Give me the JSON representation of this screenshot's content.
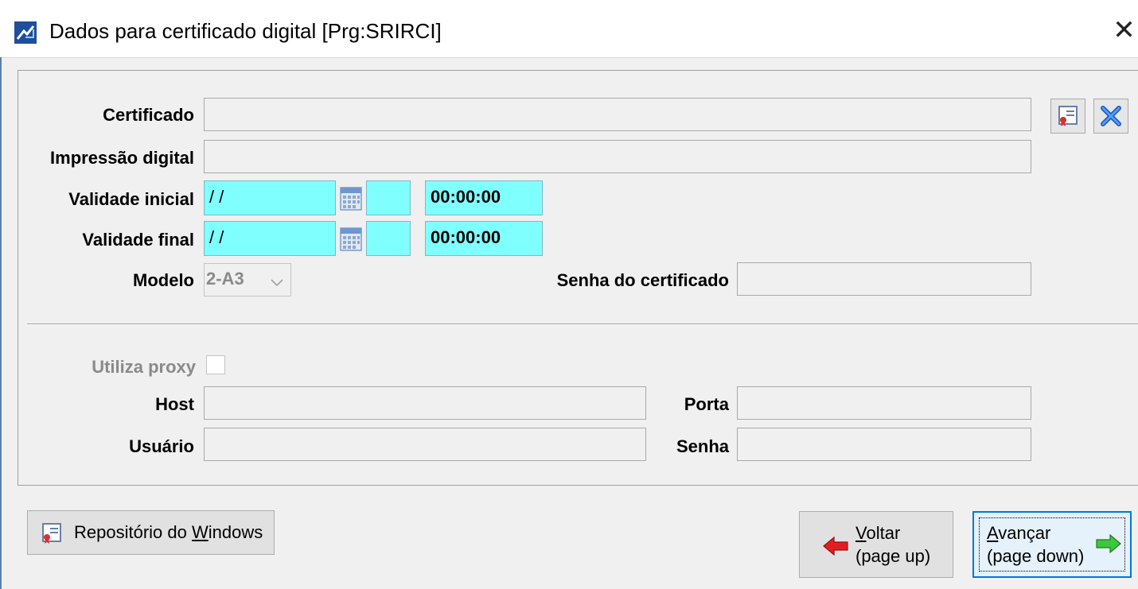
{
  "window": {
    "title": "Dados para certificado digital [Prg:SRIRCI]",
    "close_glyph": "✕"
  },
  "certificate": {
    "certificado_label": "Certificado",
    "certificado_value": "",
    "impressao_label": "Impressão digital",
    "impressao_value": "",
    "validade_inicial_label": "Validade inicial",
    "validade_inicial_date": "/ /",
    "validade_inicial_extra": "",
    "validade_inicial_time": "00:00:00",
    "validade_final_label": "Validade final",
    "validade_final_date": "/ /",
    "validade_final_extra": "",
    "validade_final_time": "00:00:00",
    "modelo_label": "Modelo",
    "modelo_value": "2-A3",
    "senha_cert_label": "Senha do certificado",
    "senha_cert_value": ""
  },
  "proxy": {
    "utiliza_label": "Utiliza proxy",
    "utiliza_checked": false,
    "host_label": "Host",
    "host_value": "",
    "porta_label": "Porta",
    "porta_value": "",
    "usuario_label": "Usuário",
    "usuario_value": "",
    "senha_label": "Senha",
    "senha_value": ""
  },
  "buttons": {
    "repo_prefix": "Repositório do ",
    "repo_hotkey": "W",
    "repo_suffix": "indows",
    "voltar_hotkey": "V",
    "voltar_rest": "oltar",
    "voltar_hint": "(page up)",
    "avancar_hotkey": "A",
    "avancar_rest": "vançar",
    "avancar_hint": "(page down)"
  },
  "colors": {
    "required_field": "#80ffff",
    "focus_border": "#0078d7",
    "back_arrow": "#e02020",
    "next_arrow": "#3cc83c"
  },
  "icons": {
    "app": "app-logo-icon",
    "certificate": "certificate-icon",
    "remove": "remove-x-icon",
    "calendar": "calendar-icon",
    "dropdown": "chevron-down-icon",
    "back": "arrow-left-icon",
    "next": "arrow-right-icon"
  }
}
